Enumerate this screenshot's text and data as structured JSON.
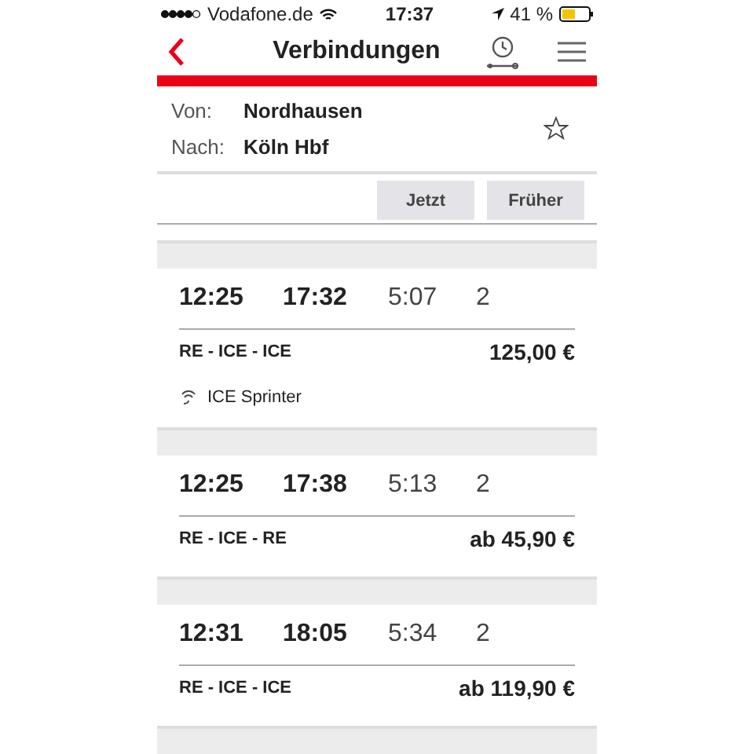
{
  "status_bar": {
    "carrier": "Vodafone.de",
    "time": "17:37",
    "battery": "41 %"
  },
  "header": {
    "title": "Verbindungen"
  },
  "route": {
    "from_label": "Von:",
    "from": "Nordhausen",
    "to_label": "Nach:",
    "to": "Köln Hbf",
    "favorite": false
  },
  "buttons": [
    "Jetzt",
    "Früher"
  ],
  "connections": [
    {
      "departure": "12:25",
      "arrival": "17:32",
      "duration": "5:07",
      "changes": "2",
      "products": "RE - ICE - ICE",
      "price": "125,00 €",
      "note": "ICE Sprinter"
    },
    {
      "departure": "12:25",
      "arrival": "17:38",
      "duration": "5:13",
      "changes": "2",
      "products": "RE - ICE - RE",
      "price": "ab 45,90 €"
    },
    {
      "departure": "12:31",
      "arrival": "18:05",
      "duration": "5:34",
      "changes": "2",
      "products": "RE - ICE - ICE",
      "price": "ab 119,90 €"
    }
  ]
}
